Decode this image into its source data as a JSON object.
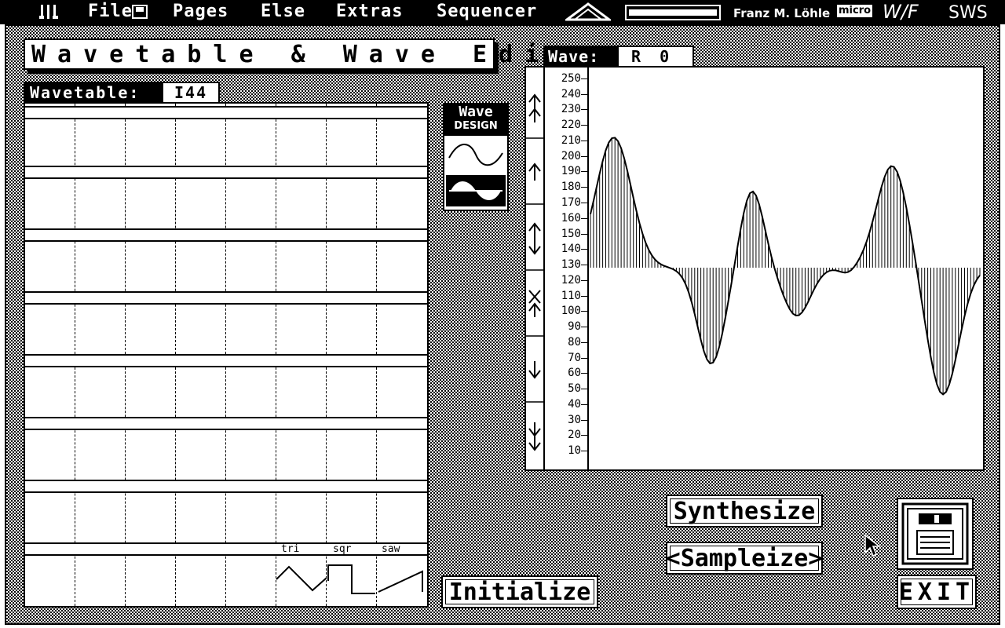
{
  "menu": {
    "atari_logo": "atari-fuji-logo",
    "items": [
      "File",
      "Pages",
      "Else",
      "Extras",
      "Sequencer"
    ],
    "credits": {
      "brand": "",
      "author": "Franz M. Löhle",
      "micro": "micro",
      "product": "W/F",
      "sws": "SWS"
    }
  },
  "title": "Wavetable & Wave Edit",
  "wavetable": {
    "label": "Wavetable:",
    "value": "I44",
    "presets": [
      "tri",
      "sqr",
      "saw"
    ]
  },
  "wave_design": {
    "title_line1": "Wave",
    "title_line2": "DESIGN",
    "icons": [
      "sine-wave-icon",
      "sine-wave-filled-icon"
    ]
  },
  "wave": {
    "label": "Wave:",
    "value": "R  0"
  },
  "y_axis": {
    "ticks": [
      250,
      240,
      230,
      220,
      210,
      200,
      190,
      180,
      170,
      160,
      150,
      140,
      130,
      120,
      110,
      100,
      90,
      80,
      70,
      60,
      50,
      40,
      30,
      20,
      10
    ],
    "ylim": [
      0,
      255
    ],
    "baseline": 128
  },
  "scroll_arrows": [
    "double-up-arrow-icon",
    "up-arrow-icon",
    "up-down-arrow-icon",
    "swap-up-arrow-icon",
    "down-arrow-icon",
    "double-down-arrow-icon"
  ],
  "buttons": {
    "synthesize": "Synthesize",
    "sampleize": "<Sampleize>",
    "initialize": "Initialize",
    "exit": "EXIT"
  },
  "disk_icon": "floppy-disk-icon",
  "cursor_icon": "mouse-pointer-icon"
}
